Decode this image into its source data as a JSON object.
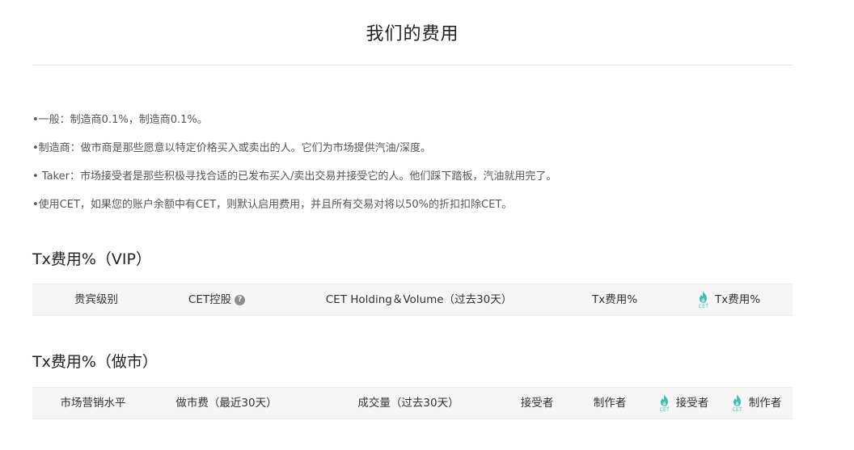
{
  "page": {
    "title": "我们的费用"
  },
  "intro": {
    "bullets": [
      "•一般：制造商0.1%，制造商0.1%。",
      "•制造商：做市商是那些愿意以特定价格买入或卖出的人。它们为市场提供汽油/深度。",
      "• Taker：市场接受者是那些积极寻找合适的已发布买入/卖出交易并接受它的人。他们踩下踏板，汽油就用完了。",
      "•使用CET，如果您的账户余额中有CET，则默认启用费用，并且所有交易对将以50%的折扣扣除CET。"
    ]
  },
  "vip_section": {
    "title": "Tx费用%（VIP）",
    "columns": {
      "level": "贵宾级别",
      "cet_holding": "CET控股",
      "holding_volume": "CET Holding＆Volume（过去30天）",
      "tx_fee": "Tx费用%",
      "cet_tx_fee": "Tx费用%"
    },
    "help_icon": "question-circle-icon"
  },
  "mm_section": {
    "title": "Tx费用%（做市）",
    "columns": {
      "market_level": "市场营销水平",
      "mm_fee": "做市费（最近30天）",
      "volume": "成交量（过去30天）",
      "taker": "接受者",
      "maker": "制作者",
      "cet_taker": "接受者",
      "cet_maker": "制作者"
    }
  },
  "cet_badge": {
    "label": "CET",
    "icon": "cet-flame-icon",
    "color": "#3fbfb3"
  },
  "colors": {
    "header_bg": "#f6f6f6",
    "text": "#333333",
    "muted_text": "#555555"
  }
}
